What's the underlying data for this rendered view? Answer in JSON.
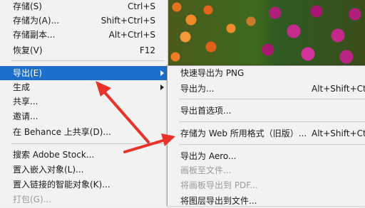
{
  "left_menu": {
    "items": [
      {
        "label": "存储(S)",
        "shortcut": "Ctrl+S"
      },
      {
        "label": "存储为(A)...",
        "shortcut": "Shift+Ctrl+S"
      },
      {
        "label": "存储副本...",
        "shortcut": "Alt+Ctrl+S"
      },
      {
        "label": "恢复(V)",
        "shortcut": "F12"
      },
      {
        "label": "导出(E)"
      },
      {
        "label": "生成"
      },
      {
        "label": "共享..."
      },
      {
        "label": "邀请..."
      },
      {
        "label": "在 Behance 上共享(D)..."
      },
      {
        "label": "搜索 Adobe Stock..."
      },
      {
        "label": "置入嵌入对象(L)..."
      },
      {
        "label": "置入链接的智能对象(K)..."
      },
      {
        "label": "打包(G)..."
      }
    ]
  },
  "export_submenu": {
    "items": [
      {
        "label": "快速导出为 PNG"
      },
      {
        "label": "导出为...",
        "shortcut": "Alt+Shift+Ctr"
      },
      {
        "label": "导出首选项..."
      },
      {
        "label": "存储为 Web 所用格式（旧版）...",
        "shortcut": "Alt+Shift+Ctr"
      },
      {
        "label": "导出为 Aero..."
      },
      {
        "label": "画板至文件..."
      },
      {
        "label": "将画板导出到 PDF..."
      },
      {
        "label": "将图层导出到文件..."
      }
    ]
  },
  "colors": {
    "highlight": "#1e6ecb",
    "annotation_arrow": "#e8332a",
    "menu_bg": "#f2f2f2"
  }
}
